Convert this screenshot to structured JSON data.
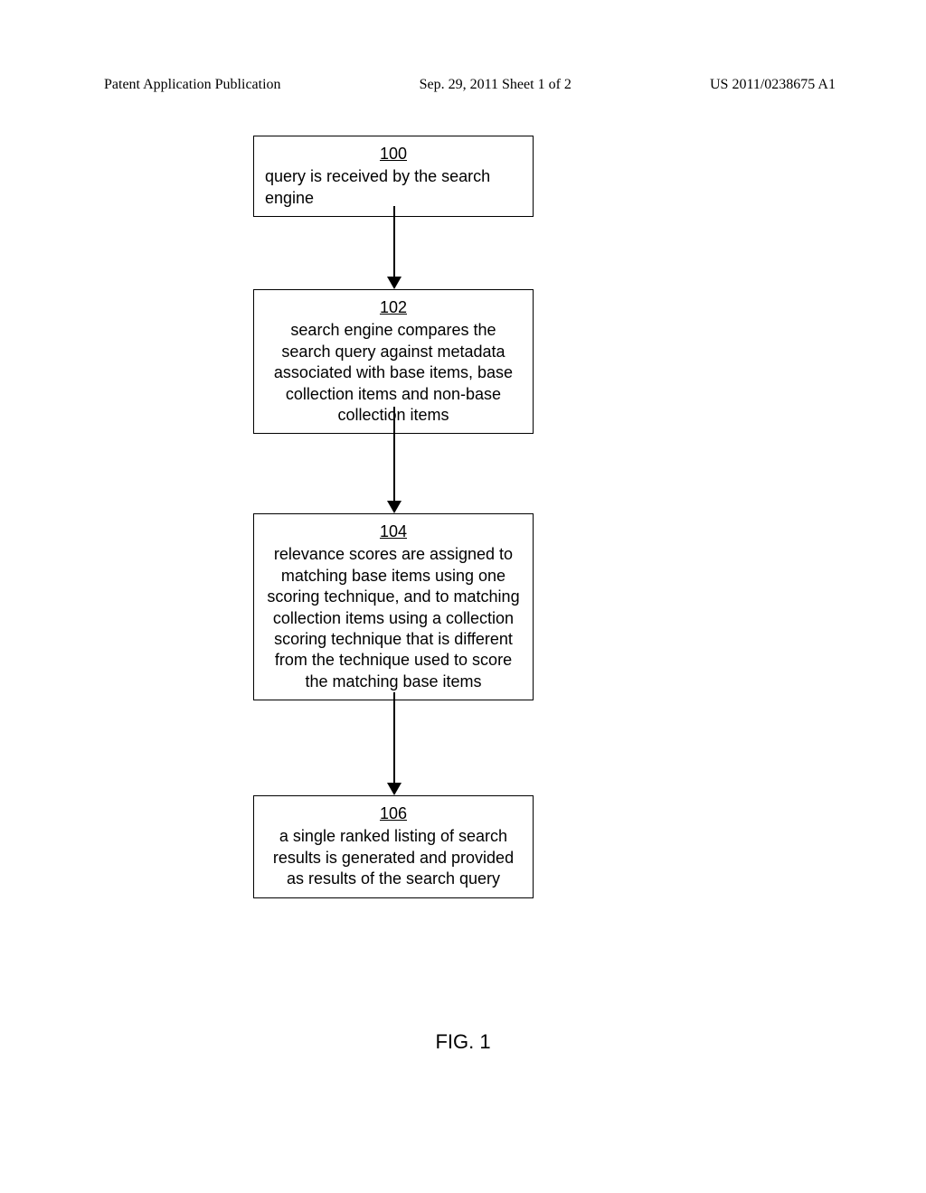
{
  "header": {
    "left": "Patent Application Publication",
    "center": "Sep. 29, 2011  Sheet 1 of 2",
    "right": "US 2011/0238675 A1"
  },
  "boxes": {
    "b1": {
      "num": "100",
      "text": "query is received by the search engine"
    },
    "b2": {
      "num": "102",
      "text": "search engine compares the search query against metadata associated with base items, base collection items and non-base collection items"
    },
    "b3": {
      "num": "104",
      "text": "relevance scores are assigned to matching base items using one scoring technique, and to matching collection items using a collection scoring technique that is different from the technique used to score the matching base items"
    },
    "b4": {
      "num": "106",
      "text": "a single ranked listing of search results is generated and provided as results of the search query"
    }
  },
  "figure_label": "FIG. 1",
  "chart_data": {
    "type": "flowchart",
    "nodes": [
      {
        "id": "100",
        "label": "query is received by the search engine"
      },
      {
        "id": "102",
        "label": "search engine compares the search query against metadata associated with base items, base collection items and non-base collection items"
      },
      {
        "id": "104",
        "label": "relevance scores are assigned to matching base items using one scoring technique, and to matching collection items using a collection scoring technique that is different from the technique used to score the matching base items"
      },
      {
        "id": "106",
        "label": "a single ranked listing of search results is generated and provided as results of the search query"
      }
    ],
    "edges": [
      {
        "from": "100",
        "to": "102"
      },
      {
        "from": "102",
        "to": "104"
      },
      {
        "from": "104",
        "to": "106"
      }
    ],
    "title": "FIG. 1"
  }
}
